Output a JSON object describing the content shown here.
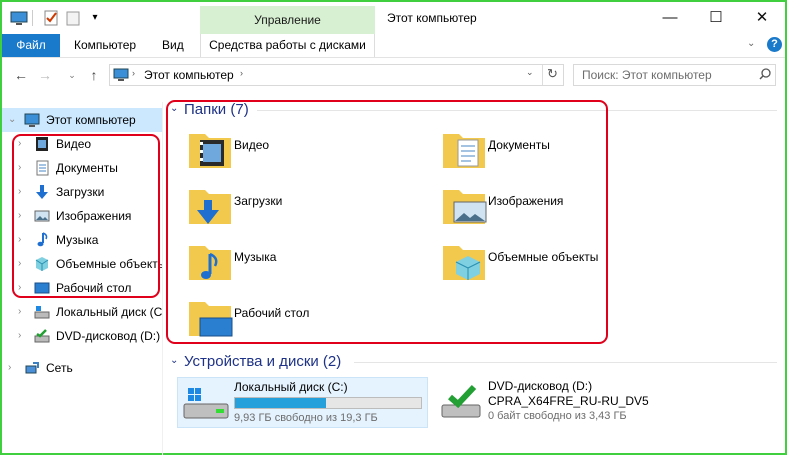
{
  "window": {
    "title": "Этот компьютер",
    "contextual_group": "Управление"
  },
  "ribbon": {
    "tabs": [
      "Файл",
      "Компьютер",
      "Вид",
      "Средства работы с дисками"
    ]
  },
  "address": {
    "path": "Этот компьютер",
    "search_placeholder": "Поиск: Этот компьютер"
  },
  "sidebar": {
    "root": "Этот компьютер",
    "items": [
      "Видео",
      "Документы",
      "Загрузки",
      "Изображения",
      "Музыка",
      "Объемные объекты",
      "Рабочий стол",
      "Локальный диск (C:)",
      "DVD-дисковод (D:)"
    ],
    "network": "Сеть"
  },
  "folders": {
    "header": "Папки (7)",
    "items": [
      "Видео",
      "Документы",
      "Загрузки",
      "Изображения",
      "Музыка",
      "Объемные объекты",
      "Рабочий стол"
    ]
  },
  "devices": {
    "header": "Устройства и диски (2)",
    "local": {
      "name": "Локальный диск (C:)",
      "free": "9,93 ГБ свободно из 19,3 ГБ",
      "used_fraction": 0.49
    },
    "dvd": {
      "name": "DVD-дисковод (D:)",
      "label": "CPRA_X64FRE_RU-RU_DV5",
      "free": "0 байт свободно из 3,43 ГБ"
    }
  },
  "colors": {
    "accent": "#1979ca",
    "highlight_border": "#e0001b",
    "selection": "#cce8ff",
    "frame": "#3fcf3f"
  }
}
